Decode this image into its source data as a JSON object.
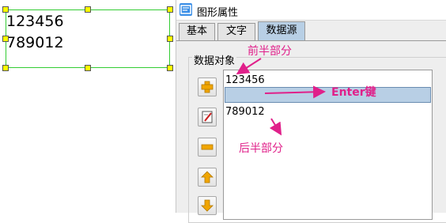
{
  "canvas": {
    "text_lines": [
      "123456",
      "789012"
    ]
  },
  "dialog": {
    "title": "图形属性",
    "icon": "properties-app-icon",
    "tabs": [
      {
        "label": "基本",
        "active": false
      },
      {
        "label": "文字",
        "active": false
      },
      {
        "label": "数据源",
        "active": true
      }
    ],
    "group_label": "数据对象",
    "toolbar": {
      "add": "add-icon",
      "edit": "edit-icon",
      "remove": "remove-icon",
      "move_up": "arrow-up-icon",
      "move_down": "arrow-down-icon"
    },
    "list_items": [
      {
        "text": "123456",
        "selected": false
      },
      {
        "text": "",
        "selected": true
      },
      {
        "text": "789012",
        "selected": false
      }
    ]
  },
  "annotations": {
    "first_half": "前半部分",
    "enter_key": "Enter键",
    "second_half": "后半部分",
    "color": "#e0208a"
  },
  "colors": {
    "selection": "#b8cfe5",
    "frame_green": "#33cc33",
    "handle_yellow": "#ffff00"
  }
}
